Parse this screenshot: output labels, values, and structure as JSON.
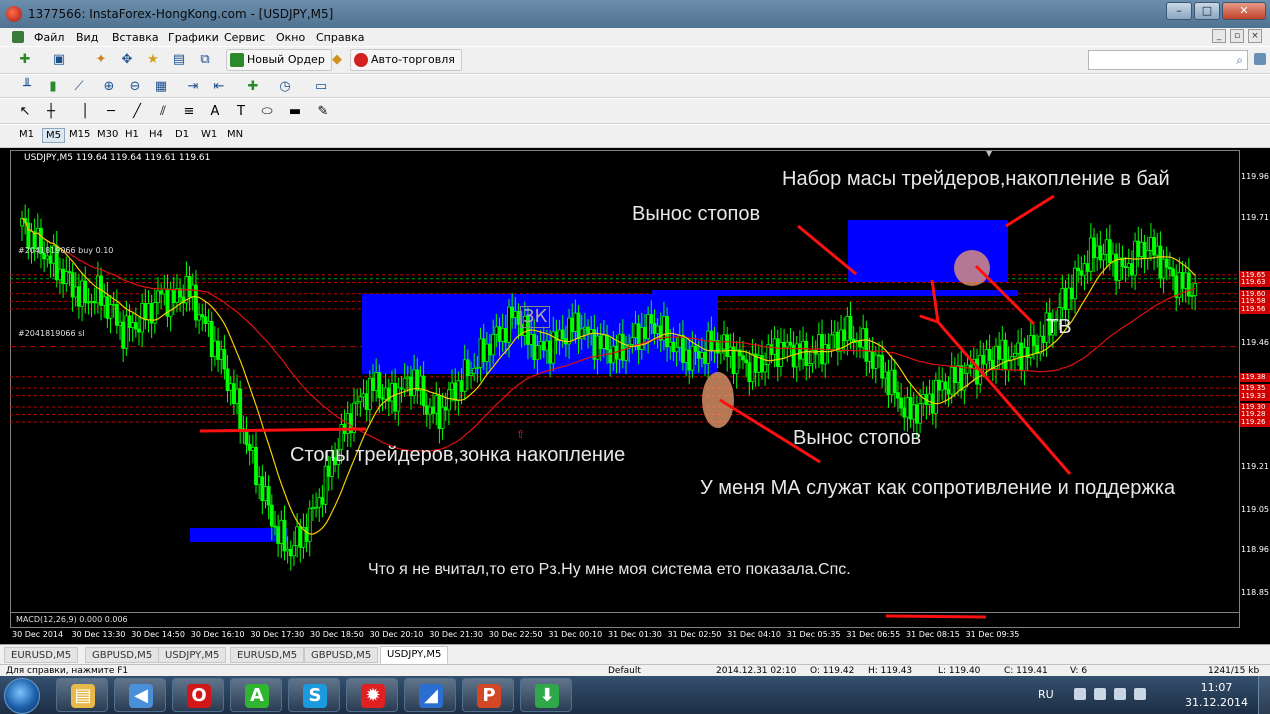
{
  "window": {
    "title": "1377566: InstaForex-HongKong.com - [USDJPY,M5]",
    "buttons": [
      "–",
      "□",
      "✕"
    ]
  },
  "menu": {
    "items": [
      "Файл",
      "Вид",
      "Вставка",
      "Графики",
      "Сервис",
      "Окно",
      "Справка"
    ]
  },
  "toolbar": {
    "new_order": "Новый Ордер",
    "auto_trading": "Авто-торговля",
    "search_placeholder": ""
  },
  "timeframes": {
    "items": [
      "M1",
      "M5",
      "M15",
      "M30",
      "H1",
      "H4",
      "D1",
      "W1",
      "MN"
    ],
    "active": "M5"
  },
  "chart": {
    "info_line": "USDJPY,M5  119.64 119.64 119.61 119.61",
    "order_buy_label": "#2041819066 buy 0.10",
    "order_sl_label": "#2041819066 sl",
    "macd_label": "MACD(12,26,9) 0.000 0.006",
    "zk_label": "ЗК",
    "colors": {
      "candle": "#00ff00",
      "ma_fast": "#f0d000",
      "ma_slow": "#e01010",
      "box": "#0000ff",
      "annotation_line": "#ff1010",
      "zone_highlight": "#f0a070"
    }
  },
  "annotations": {
    "mass_gain": "Набор масы трейдеров,накопление в бай",
    "stops_out_top": "Вынос стопов",
    "tv": "ТВ",
    "stops_out_bottom": "Вынос стопов",
    "stops_zone": "Стопы трейдеров,зонка накопление",
    "ma_role": "У меня МА служат как сопротивление и поддержка",
    "footnote": "Что я не вчитал,то ето Рз.Ну мне моя система ето показала.Спс."
  },
  "chart_data": {
    "type": "candlestick",
    "symbol": "USDJPY",
    "timeframe": "M5",
    "price_ticks": [
      "119.96",
      "119.71",
      "119.46",
      "119.21",
      "119.05",
      "118.96",
      "118.85"
    ],
    "price_flags": [
      "119.65",
      "119.63",
      "119.60",
      "119.58",
      "119.56",
      "119.38",
      "119.35",
      "119.33",
      "119.30",
      "119.28",
      "119.26"
    ],
    "time_ticks": [
      "30 Dec 2014",
      "30 Dec 13:30",
      "30 Dec 14:50",
      "30 Dec 16:10",
      "30 Dec 17:30",
      "30 Dec 18:50",
      "30 Dec 20:10",
      "30 Dec 21:30",
      "30 Dec 22:50",
      "31 Dec 00:10",
      "31 Dec 01:30",
      "31 Dec 02:50",
      "31 Dec 04:10",
      "31 Dec 05:35",
      "31 Dec 06:55",
      "31 Dec 08:15",
      "31 Dec 09:35"
    ],
    "close_path": [
      119.78,
      119.74,
      119.7,
      119.66,
      119.62,
      119.58,
      119.6,
      119.56,
      119.5,
      119.52,
      119.55,
      119.6,
      119.58,
      119.62,
      119.55,
      119.48,
      119.4,
      119.3,
      119.18,
      119.08,
      118.98,
      118.92,
      118.95,
      119.02,
      119.1,
      119.2,
      119.28,
      119.33,
      119.36,
      119.32,
      119.35,
      119.38,
      119.3,
      119.28,
      119.34,
      119.38,
      119.42,
      119.47,
      119.5,
      119.55,
      119.48,
      119.45,
      119.47,
      119.5,
      119.52,
      119.48,
      119.46,
      119.44,
      119.47,
      119.5,
      119.52,
      119.48,
      119.45,
      119.43,
      119.45,
      119.47,
      119.44,
      119.42,
      119.4,
      119.44,
      119.46,
      119.45,
      119.43,
      119.45,
      119.47,
      119.5,
      119.48,
      119.44,
      119.4,
      119.34,
      119.28,
      119.3,
      119.33,
      119.36,
      119.38,
      119.4,
      119.42,
      119.44,
      119.43,
      119.44,
      119.46,
      119.5,
      119.56,
      119.62,
      119.68,
      119.72,
      119.7,
      119.66,
      119.7,
      119.73,
      119.69,
      119.64,
      119.62,
      119.61
    ]
  },
  "tabs": {
    "items": [
      "EURUSD,M5",
      "GBPUSD,M5",
      "USDJPY,M5",
      "EURUSD,M5",
      "GBPUSD,M5",
      "USDJPY,M5"
    ],
    "active_index": 5
  },
  "status": {
    "help": "Для справки, нажмите F1",
    "profile": "Default",
    "datetime": "2014.12.31 02:10",
    "open": "O: 119.42",
    "high": "H: 119.43",
    "low": "L: 119.40",
    "close": "C: 119.41",
    "volume": "V: 6",
    "traffic": "1241/15 kb"
  },
  "taskbar": {
    "apps": [
      {
        "name": "file-explorer",
        "glyph": "▤",
        "color": "#e8b84a"
      },
      {
        "name": "media-player",
        "glyph": "◀",
        "color": "#4a90d8"
      },
      {
        "name": "opera-browser",
        "glyph": "O",
        "color": "#d01818"
      },
      {
        "name": "a-app",
        "glyph": "A",
        "color": "#2fb52f"
      },
      {
        "name": "skype",
        "glyph": "S",
        "color": "#1c9ae0"
      },
      {
        "name": "gear-app",
        "glyph": "✹",
        "color": "#e02020"
      },
      {
        "name": "terminal-app",
        "glyph": "◢",
        "color": "#2a6fd0"
      },
      {
        "name": "powerpoint",
        "glyph": "P",
        "color": "#d24726"
      },
      {
        "name": "shield-app",
        "glyph": "⬇",
        "color": "#2fa84a"
      }
    ],
    "lang": "RU",
    "time": "11:07",
    "date": "31.12.2014"
  }
}
